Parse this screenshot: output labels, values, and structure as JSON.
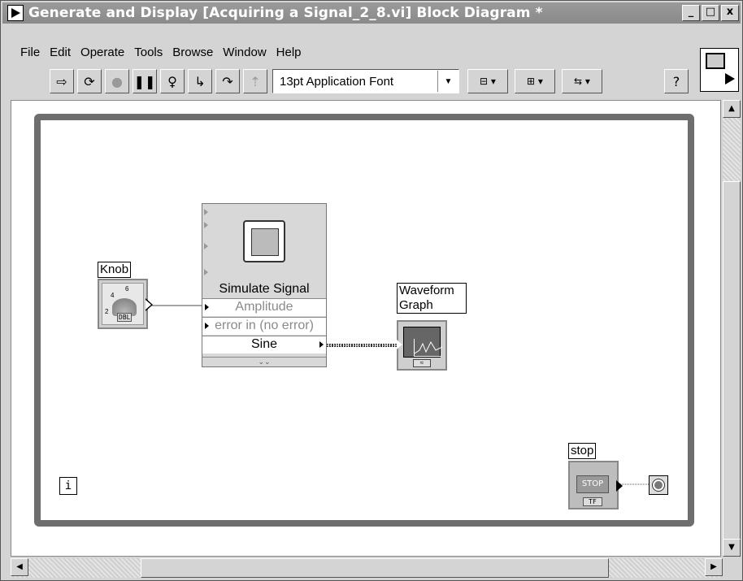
{
  "window": {
    "title": "Generate and Display [Acquiring a Signal_2_8.vi] Block Diagram *",
    "controls": [
      "_",
      "□",
      "x"
    ]
  },
  "menubar": {
    "items": [
      "File",
      "Edit",
      "Operate",
      "Tools",
      "Browse",
      "Window",
      "Help"
    ]
  },
  "toolbar": {
    "run_icon": "run-arrow-icon",
    "run_continuous_icon": "run-continuously-icon",
    "abort_icon": "abort-icon",
    "pause_icon": "pause-icon",
    "highlight_icon": "lightbulb-icon",
    "step_into_icon": "step-into-icon",
    "step_over_icon": "step-over-icon",
    "step_out_icon": "step-out-icon",
    "font_value": "13pt Application Font",
    "align_icon": "align-objects-icon",
    "distribute_icon": "distribute-objects-icon",
    "reorder_icon": "reorder-icon",
    "help_label": "?"
  },
  "diagram": {
    "loop_iteration_label": "i",
    "knob": {
      "label": "Knob",
      "type_badge": "DBL",
      "scale": [
        "2",
        "4",
        "6"
      ]
    },
    "simulate_signal": {
      "title": "Simulate Signal",
      "inputs": [
        "Amplitude",
        "error in (no error)"
      ],
      "output": "Sine"
    },
    "waveform_graph": {
      "label": "Waveform Graph",
      "label_line1": "Waveform",
      "label_line2": "Graph"
    },
    "stop": {
      "label": "stop",
      "button_text": "STOP",
      "type_badge": "TF"
    }
  },
  "colors": {
    "titlebar": "#8a8a8a",
    "loop_border": "#6e6e6e",
    "canvas": "#ffffff"
  }
}
